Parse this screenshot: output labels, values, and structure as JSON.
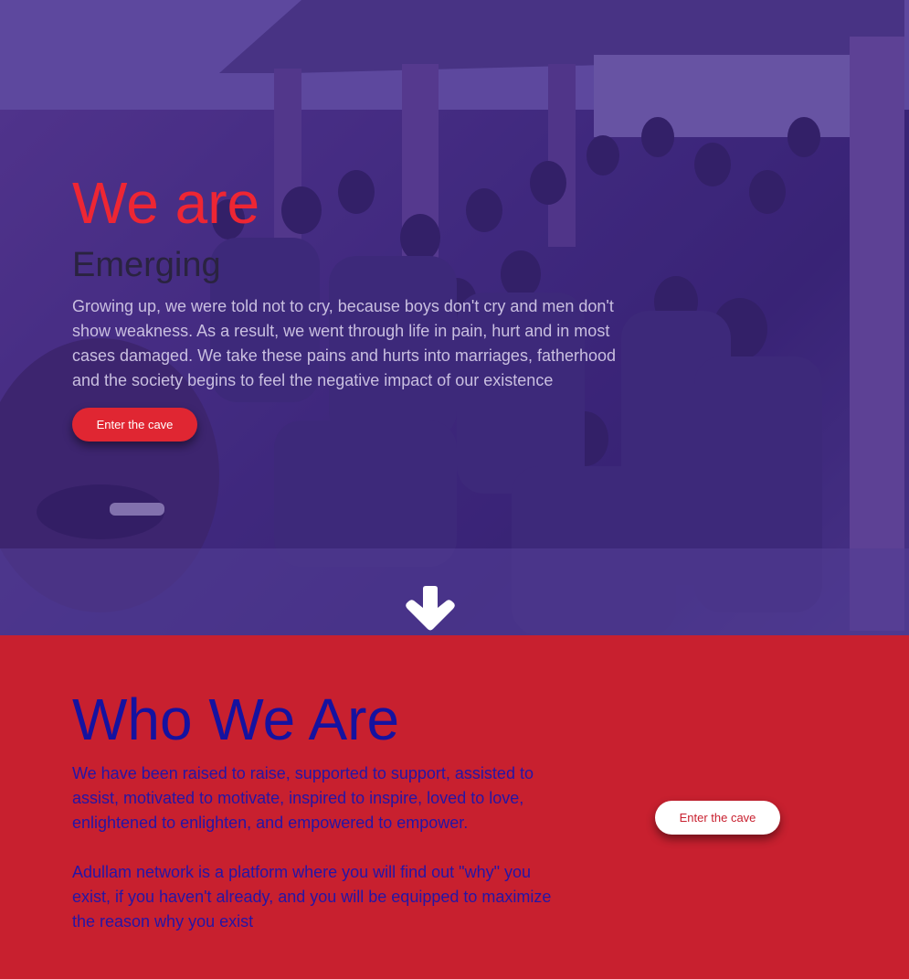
{
  "hero": {
    "title": "We are",
    "subtitle": "Emerging",
    "text": "Growing up, we were told not to cry, because boys don't cry and men don't show weakness. As a result, we went through life in pain, hurt and in most cases damaged. We take these pains and hurts into marriages, fatherhood and the society begins to feel the negative impact of our existence",
    "cta_label": "Enter the cave",
    "scroll_icon": "arrow-down-icon"
  },
  "about": {
    "title": "Who We Are",
    "paragraph1": "We have been raised to raise, supported to support, assisted to assist, motivated to motivate, inspired to inspire, loved to love, enlightened to enlighten, and empowered to empower.",
    "paragraph2": "Adullam network is a platform where you will find out \"why\" you exist, if you haven't already, and you will be equipped to maximize the reason why you exist",
    "cta_label": "Enter the cave"
  },
  "colors": {
    "accent_red": "#e02632",
    "section_red": "#c8202f",
    "title_blue": "#1512a0",
    "overlay_purple": "#4a3a86"
  }
}
